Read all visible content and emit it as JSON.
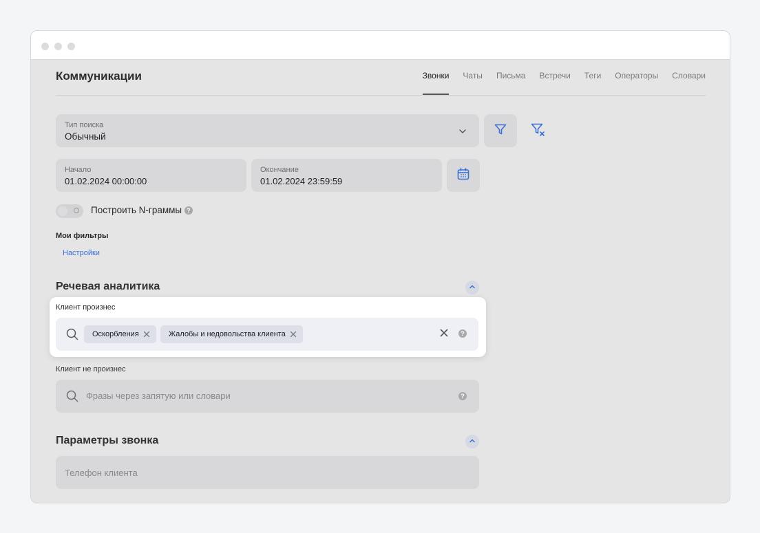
{
  "header": {
    "title": "Коммуникации",
    "tabs": [
      {
        "label": "Звонки",
        "active": true
      },
      {
        "label": "Чаты",
        "active": false
      },
      {
        "label": "Письма",
        "active": false
      },
      {
        "label": "Встречи",
        "active": false
      },
      {
        "label": "Теги",
        "active": false
      },
      {
        "label": "Операторы",
        "active": false
      },
      {
        "label": "Словари",
        "active": false
      }
    ]
  },
  "search_type": {
    "label": "Тип поиска",
    "value": "Обычный"
  },
  "date_range": {
    "start": {
      "label": "Начало",
      "value": "01.02.2024 00:00:00"
    },
    "end": {
      "label": "Окончание",
      "value": "01.02.2024 23:59:59"
    }
  },
  "ngram": {
    "label": "Построить N-граммы",
    "enabled": false
  },
  "my_filters": {
    "title": "Мои фильтры",
    "settings_link": "Настройки"
  },
  "speech_analytics": {
    "title": "Речевая аналитика",
    "client_said": {
      "label": "Клиент произнес",
      "chips": [
        "Оскорбления",
        "Жалобы и недовольства клиента"
      ]
    },
    "client_not_said": {
      "label": "Клиент не произнес",
      "placeholder": "Фразы через запятую или словари"
    }
  },
  "call_params": {
    "title": "Параметры звонка",
    "phone_placeholder": "Телефон клиента"
  },
  "colors": {
    "accent": "#3b6fd6",
    "window_bg": "#e5e5e6",
    "field_bg": "#d8d8da"
  }
}
